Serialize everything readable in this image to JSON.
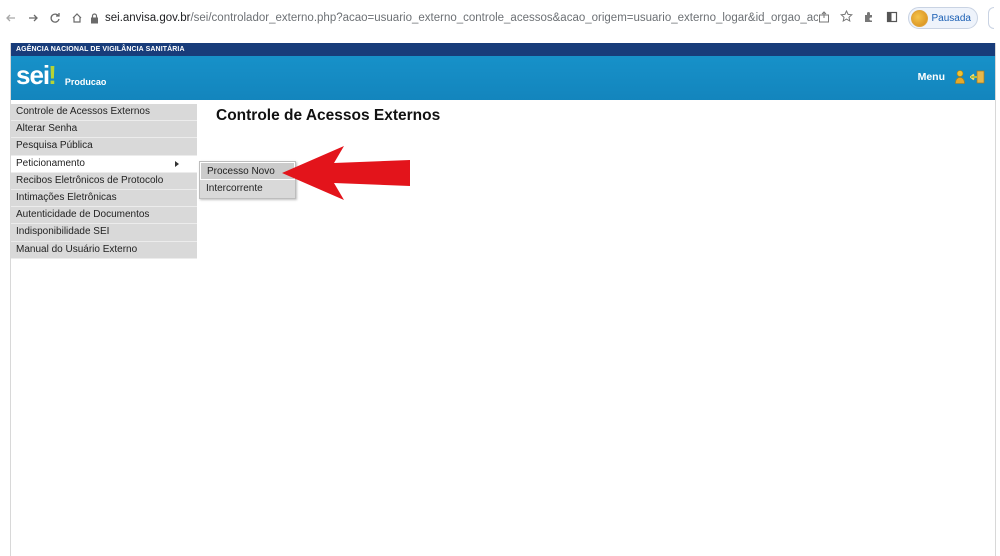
{
  "browser": {
    "url_domain": "sei.anvisa.gov.br",
    "url_rest": "/sei/controlador_externo.php?acao=usuario_externo_controle_acessos&acao_origem=usuario_externo_logar&id_orgao_acesso_exte...",
    "profile_label": "Pausada",
    "icons": [
      "back-icon",
      "forward-icon",
      "reload-icon",
      "home-icon",
      "lock-icon",
      "share-icon",
      "star-icon",
      "extensions-icon",
      "sidepanel-icon"
    ]
  },
  "sei": {
    "org_name": "AGÊNCIA NACIONAL DE VIGILÂNCIA SANITÁRIA",
    "logo_text": "sei",
    "logo_excl": "!",
    "env_label": "Producao",
    "menu_label": "Menu"
  },
  "sidebar": {
    "items": [
      {
        "label": "Controle de Acessos Externos"
      },
      {
        "label": "Alterar Senha"
      },
      {
        "label": "Pesquisa Pública"
      },
      {
        "label": "Peticionamento"
      },
      {
        "label": "Recibos Eletrônicos de Protocolo"
      },
      {
        "label": "Intimações Eletrônicas"
      },
      {
        "label": "Autenticidade de Documentos"
      },
      {
        "label": "Indisponibilidade SEI"
      },
      {
        "label": "Manual do Usuário Externo"
      }
    ]
  },
  "submenu": {
    "items": [
      {
        "label": "Processo Novo"
      },
      {
        "label": "Intercorrente"
      }
    ]
  },
  "main": {
    "title": "Controle de Acessos Externos"
  },
  "colors": {
    "header_blue": "#1791c9",
    "topstrip_navy": "#183c7a",
    "sidebar_gray": "#d9d9d9",
    "arrow_red": "#e3141b",
    "logo_green": "#b7d435"
  }
}
